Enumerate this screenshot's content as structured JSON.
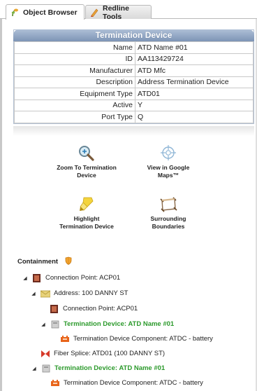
{
  "tabs": [
    {
      "label": "Object Browser"
    },
    {
      "label": "Redline Tools"
    }
  ],
  "panel": {
    "title": "Termination Device",
    "rows": [
      {
        "label": "Name",
        "value": "ATD Name #01"
      },
      {
        "label": "ID",
        "value": "AA113429724"
      },
      {
        "label": "Manufacturer",
        "value": "ATD Mfc"
      },
      {
        "label": "Description",
        "value": "Address Termination Device"
      },
      {
        "label": "Equipment Type",
        "value": "ATD01"
      },
      {
        "label": "Active",
        "value": "Y"
      },
      {
        "label": "Port Type",
        "value": "Q"
      }
    ]
  },
  "actions": {
    "zoom": {
      "line1": "Zoom To Termination",
      "line2": "Device"
    },
    "google": {
      "line1": "View in Google",
      "line2": "Maps™"
    },
    "highlight": {
      "line1": "Highlight",
      "line2": "Termination Device"
    },
    "boundaries": {
      "line1": "Surrounding",
      "line2": "Boundaries"
    }
  },
  "containment": {
    "title": "Containment",
    "tree": [
      {
        "text": "Connection Point: ACP01",
        "icon": "connection-point-icon"
      },
      {
        "text": "Address: 100 DANNY ST",
        "icon": "address-envelope-icon"
      },
      {
        "text": "Connection Point: ACP01",
        "icon": "connection-point-icon"
      },
      {
        "text": "Termination Device: ATD Name #01",
        "icon": "termination-device-icon"
      },
      {
        "text": "Termination Device Component: ATDC - battery",
        "icon": "component-icon"
      },
      {
        "text": "Fiber Splice: ATD01 (100 DANNY ST)",
        "icon": "fiber-splice-icon"
      },
      {
        "text": "Termination Device: ATD Name #01",
        "icon": "termination-device-icon"
      },
      {
        "text": "Termination Device Component: ATDC - battery",
        "icon": "component-icon"
      }
    ]
  },
  "colors": {
    "header_blue": "#7d94b6",
    "highlight_green": "#2c9a2c",
    "component_orange": "#e8641a"
  }
}
